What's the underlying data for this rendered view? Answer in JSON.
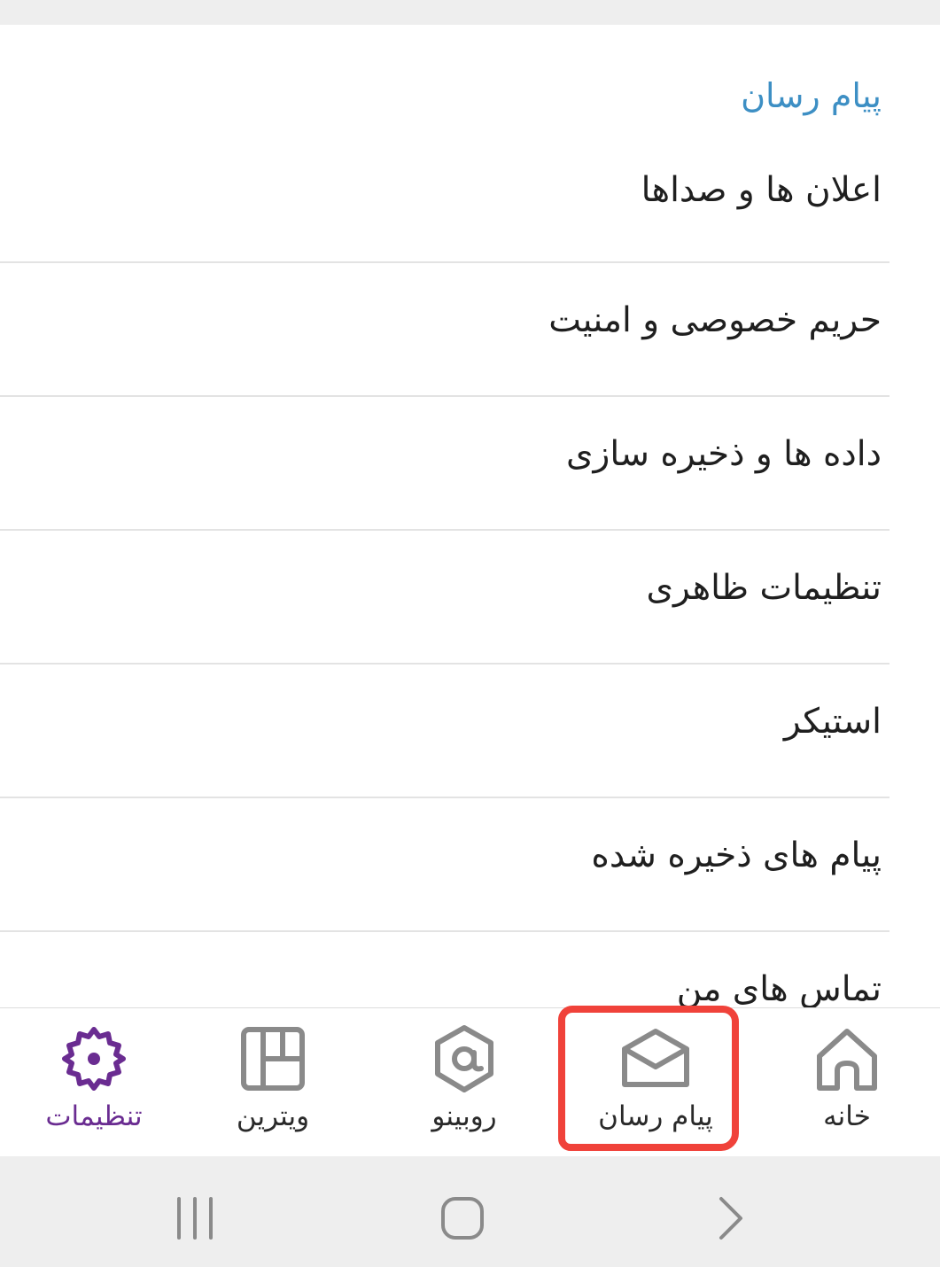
{
  "section": {
    "title": "پیام رسان"
  },
  "menu": {
    "items": [
      {
        "label": "اعلان ها و صداها"
      },
      {
        "label": "حریم خصوصی و امنیت"
      },
      {
        "label": "داده ها و ذخیره سازی"
      },
      {
        "label": "تنظیمات ظاهری"
      },
      {
        "label": "استیکر"
      },
      {
        "label": "پیام های ذخیره شده"
      },
      {
        "label": "تماس های من"
      }
    ]
  },
  "bottom_nav": {
    "active": "settings",
    "items": [
      {
        "id": "home",
        "label": "خانه",
        "icon": "home-icon"
      },
      {
        "id": "messenger",
        "label": "پیام رسان",
        "icon": "envelope-icon"
      },
      {
        "id": "rubino",
        "label": "روبینو",
        "icon": "at-icon"
      },
      {
        "id": "vitrin",
        "label": "ویترین",
        "icon": "grid-icon"
      },
      {
        "id": "settings",
        "label": "تنظیمات",
        "icon": "gear-icon"
      }
    ]
  },
  "colors": {
    "accent_blue": "#3d8fc4",
    "active_purple": "#6a2c91",
    "highlight_red": "#f0423a",
    "icon_gray": "#8a8a8a"
  },
  "system_nav": {
    "recents": "recents-icon",
    "home": "home-button-icon",
    "back": "back-icon"
  }
}
